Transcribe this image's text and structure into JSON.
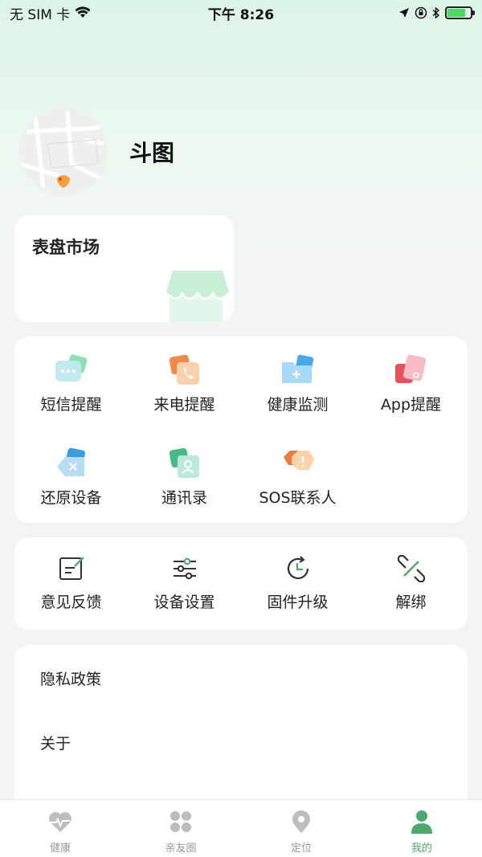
{
  "status_bar": {
    "carrier": "无 SIM 卡",
    "time": "下午 8:26"
  },
  "profile": {
    "name": "斗图"
  },
  "market": {
    "title": "表盘市场"
  },
  "features": [
    {
      "label": "短信提醒",
      "icon": "message-icon"
    },
    {
      "label": "来电提醒",
      "icon": "phone-icon"
    },
    {
      "label": "健康监测",
      "icon": "health-folder-icon"
    },
    {
      "label": "App提醒",
      "icon": "app-icon"
    },
    {
      "label": "还原设备",
      "icon": "restore-icon"
    },
    {
      "label": "通讯录",
      "icon": "contacts-icon"
    },
    {
      "label": "SOS联系人",
      "icon": "sos-icon"
    }
  ],
  "tools": [
    {
      "label": "意见反馈",
      "icon": "feedback-icon"
    },
    {
      "label": "设备设置",
      "icon": "sliders-icon"
    },
    {
      "label": "固件升级",
      "icon": "clock-refresh-icon"
    },
    {
      "label": "解绑",
      "icon": "unlink-icon"
    }
  ],
  "list": [
    {
      "label": "隐私政策"
    },
    {
      "label": "关于"
    }
  ],
  "tabs": [
    {
      "label": "健康",
      "icon": "heart-pulse-icon",
      "active": false
    },
    {
      "label": "亲友圈",
      "icon": "clover-icon",
      "active": false
    },
    {
      "label": "定位",
      "icon": "location-pin-icon",
      "active": false
    },
    {
      "label": "我的",
      "icon": "person-icon",
      "active": true
    }
  ],
  "colors": {
    "accent": "#4caa6d",
    "inactive": "#9a9a9a",
    "header_gradient": "#dcf5e6",
    "background": "#f3f4f6"
  }
}
